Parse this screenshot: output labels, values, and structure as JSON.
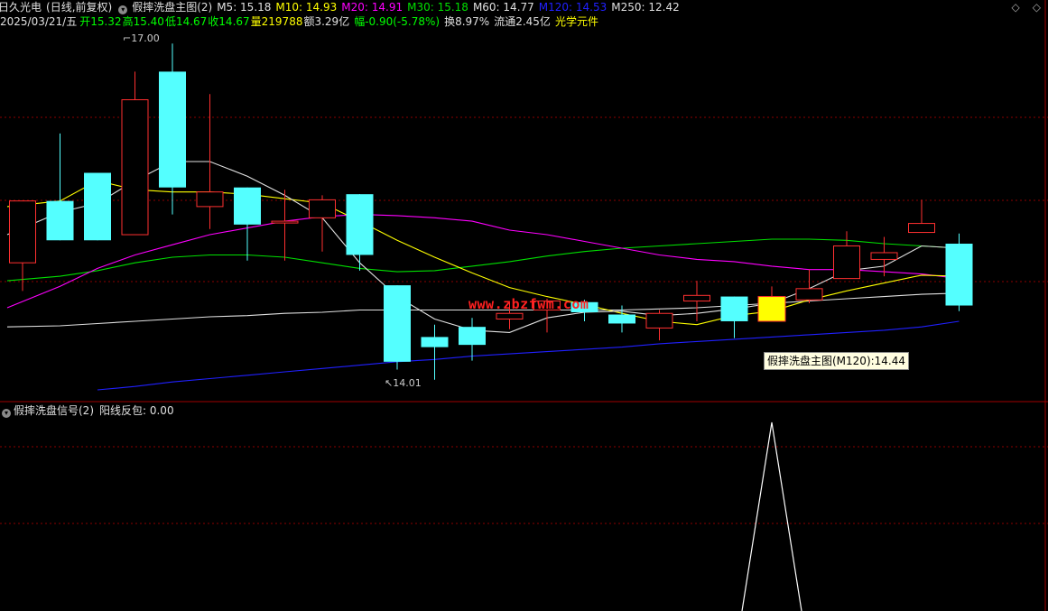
{
  "header": {
    "stock_name": "日久光电",
    "period": "(日线,前复权)",
    "indicator_name": "假摔洗盘主图(2)",
    "ma_labels": [
      {
        "text": "M5: 15.18",
        "color": "#e0e0e0"
      },
      {
        "text": "M10: 14.93",
        "color": "#ffff00"
      },
      {
        "text": "M20: 14.91",
        "color": "#ff00ff"
      },
      {
        "text": "M30: 15.18",
        "color": "#00e000"
      },
      {
        "text": "M60: 14.77",
        "color": "#e0e0e0"
      },
      {
        "text": "M120: 14.53",
        "color": "#2020ff"
      },
      {
        "text": "M250: 12.42",
        "color": "#e0e0e0"
      }
    ],
    "date": "2025/03/21/五",
    "open": "开15.32",
    "high": "高15.40",
    "low": "低14.67",
    "close": "收14.67",
    "volume": "量219788",
    "amount": "额3.29亿",
    "change": "幅-0.90(-5.78%)",
    "turnover": "换8.97%",
    "float_cap": "流通2.45亿",
    "sector": "光学元件"
  },
  "colors": {
    "up": "#ff3030",
    "down": "#54ffff",
    "signal": "#ffff00",
    "grid": "#8b0000",
    "m5": "#e0e0e0",
    "m10": "#ffff00",
    "m20": "#ff00ff",
    "m30": "#00e000",
    "m60": "#e0e0e0",
    "m120": "#2020ff"
  },
  "markers": {
    "high_label": "17.00",
    "low_label": "14.01"
  },
  "tooltip": {
    "text": "假摔洗盘主图(M120):14.44"
  },
  "watermark": {
    "text": "www.zbzfwm.com"
  },
  "sub_panel": {
    "name": "假摔洗盘信号(2)",
    "value_label": "阳线反包: 0.00"
  },
  "window": {
    "min_icon": "◇",
    "max_icon": "◇"
  },
  "chart_data": {
    "type": "candlestick",
    "price_range": [
      14.0,
      17.05
    ],
    "candles": [
      {
        "o": 15.05,
        "h": 15.4,
        "l": 14.8,
        "c": 15.6,
        "signal": false
      },
      {
        "o": 15.6,
        "h": 16.2,
        "l": 15.32,
        "c": 15.25,
        "signal": false
      },
      {
        "o": 15.85,
        "h": 15.85,
        "l": 15.25,
        "c": 15.25,
        "signal": false
      },
      {
        "o": 15.3,
        "h": 16.75,
        "l": 15.45,
        "c": 16.5,
        "signal": false
      },
      {
        "o": 16.75,
        "h": 17.0,
        "l": 15.48,
        "c": 15.72,
        "signal": false
      },
      {
        "o": 15.55,
        "h": 16.55,
        "l": 15.35,
        "c": 15.68,
        "signal": false
      },
      {
        "o": 15.72,
        "h": 15.72,
        "l": 15.07,
        "c": 15.39,
        "signal": false
      },
      {
        "o": 15.42,
        "h": 15.7,
        "l": 15.07,
        "c": 15.42,
        "signal": false
      },
      {
        "o": 15.45,
        "h": 15.65,
        "l": 15.15,
        "c": 15.61,
        "signal": false
      },
      {
        "o": 15.66,
        "h": 15.66,
        "l": 14.98,
        "c": 15.12,
        "signal": false
      },
      {
        "o": 14.85,
        "h": 14.85,
        "l": 14.1,
        "c": 14.17,
        "signal": false
      },
      {
        "o": 14.39,
        "h": 14.5,
        "l": 14.01,
        "c": 14.3,
        "signal": false
      },
      {
        "o": 14.48,
        "h": 14.56,
        "l": 14.18,
        "c": 14.32,
        "signal": false
      },
      {
        "o": 14.55,
        "h": 14.71,
        "l": 14.46,
        "c": 14.6,
        "signal": false
      },
      {
        "o": 14.63,
        "h": 14.73,
        "l": 14.43,
        "c": 14.71,
        "signal": false
      },
      {
        "o": 14.7,
        "h": 14.72,
        "l": 14.53,
        "c": 14.61,
        "signal": false
      },
      {
        "o": 14.59,
        "h": 14.67,
        "l": 14.43,
        "c": 14.51,
        "signal": false
      },
      {
        "o": 14.47,
        "h": 14.63,
        "l": 14.36,
        "c": 14.6,
        "signal": false
      },
      {
        "o": 14.71,
        "h": 14.89,
        "l": 14.53,
        "c": 14.76,
        "signal": false
      },
      {
        "o": 14.75,
        "h": 14.75,
        "l": 14.38,
        "c": 14.53,
        "signal": false
      },
      {
        "o": 14.53,
        "h": 14.84,
        "l": 14.53,
        "c": 14.75,
        "signal": true
      },
      {
        "o": 14.72,
        "h": 14.99,
        "l": 14.69,
        "c": 14.82,
        "signal": false
      },
      {
        "o": 14.91,
        "h": 15.33,
        "l": 14.92,
        "c": 15.2,
        "signal": false
      },
      {
        "o": 15.08,
        "h": 15.28,
        "l": 14.93,
        "c": 15.14,
        "signal": false
      },
      {
        "o": 15.32,
        "h": 15.61,
        "l": 15.4,
        "c": 15.4,
        "signal": false
      },
      {
        "o": 15.22,
        "h": 15.31,
        "l": 14.62,
        "c": 14.67,
        "signal": false
      }
    ],
    "ma5": [
      15.3,
      15.5,
      15.58,
      15.78,
      15.95,
      15.95,
      15.82,
      15.65,
      15.45,
      15.05,
      14.75,
      14.55,
      14.45,
      14.43,
      14.56,
      14.61,
      14.62,
      14.58,
      14.6,
      14.64,
      14.69,
      14.82,
      14.98,
      15.02,
      15.2,
      15.18
    ],
    "ma10": [
      15.55,
      15.6,
      15.78,
      15.7,
      15.68,
      15.68,
      15.66,
      15.62,
      15.58,
      15.42,
      15.25,
      15.1,
      14.96,
      14.83,
      14.75,
      14.68,
      14.6,
      14.53,
      14.5,
      14.58,
      14.62,
      14.72,
      14.8,
      14.87,
      14.94,
      14.93
    ],
    "ma20": [
      14.65,
      14.84,
      15.0,
      15.12,
      15.21,
      15.3,
      15.36,
      15.42,
      15.46,
      15.48,
      15.47,
      15.45,
      15.42,
      15.34,
      15.3,
      15.24,
      15.18,
      15.12,
      15.08,
      15.06,
      15.02,
      14.99,
      14.99,
      14.97,
      14.95,
      14.91
    ],
    "ma30": [
      14.89,
      14.93,
      14.98,
      15.05,
      15.1,
      15.12,
      15.12,
      15.1,
      15.05,
      15.0,
      14.97,
      14.98,
      15.02,
      15.06,
      15.11,
      15.15,
      15.18,
      15.2,
      15.22,
      15.24,
      15.26,
      15.26,
      15.25,
      15.22,
      15.2,
      15.18
    ],
    "ma60": [
      14.48,
      14.49,
      14.51,
      14.53,
      14.55,
      14.57,
      14.58,
      14.6,
      14.61,
      14.63,
      14.63,
      14.63,
      14.63,
      14.63,
      14.63,
      14.63,
      14.63,
      14.64,
      14.65,
      14.67,
      14.69,
      14.71,
      14.73,
      14.75,
      14.77,
      14.78
    ],
    "ma120": [
      null,
      null,
      13.92,
      13.95,
      13.99,
      14.02,
      14.05,
      14.08,
      14.11,
      14.14,
      14.17,
      14.19,
      14.22,
      14.24,
      14.26,
      14.28,
      14.3,
      14.33,
      14.35,
      14.37,
      14.39,
      14.41,
      14.43,
      14.45,
      14.48,
      14.53
    ]
  }
}
